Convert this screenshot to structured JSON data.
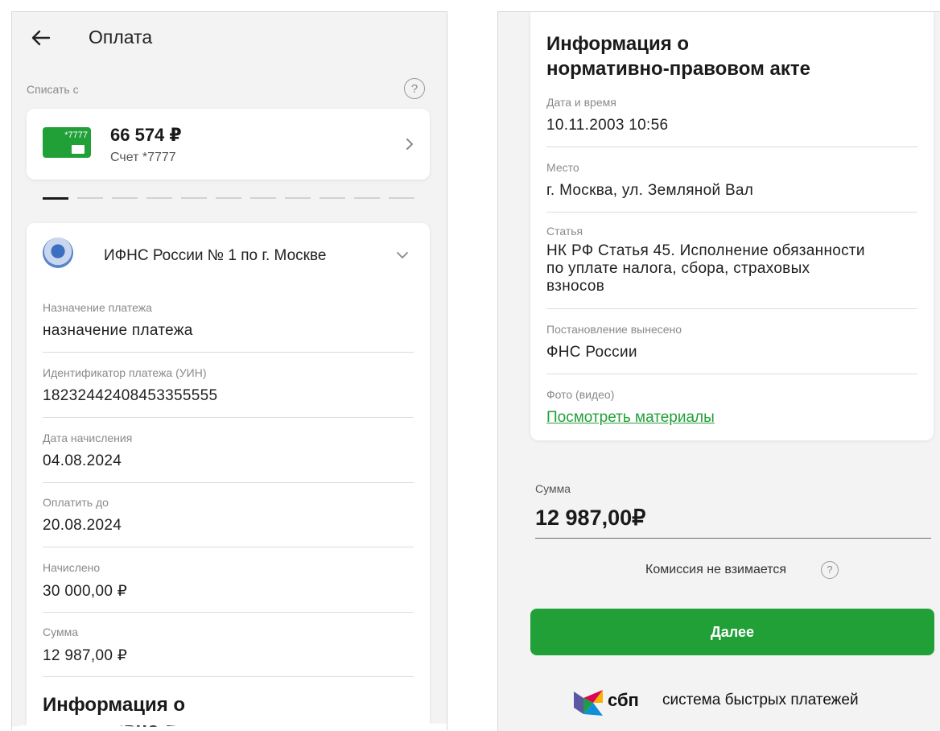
{
  "left": {
    "title": "Оплата",
    "debit_from_label": "Списать с",
    "help_glyph": "?",
    "account": {
      "card_number": "*7777",
      "balance": "66 574 ₽",
      "name": "Счет *7777"
    },
    "pager": {
      "total": 11,
      "active_index": 0
    },
    "payee": {
      "name": "ИФНС России № 1 по г. Москве",
      "fields": [
        {
          "label": "Назначение платежа",
          "value": "назначение платежа"
        },
        {
          "label": "Идентификатор платежа (УИН)",
          "value": "18232442408453355555"
        },
        {
          "label": "Дата начисления",
          "value": "04.08.2024"
        },
        {
          "label": "Оплатить до",
          "value": "20.08.2024"
        },
        {
          "label": "Начислено",
          "value": "30 000,00 ₽"
        },
        {
          "label": "Сумма",
          "value": "12 987,00 ₽"
        }
      ],
      "info_heading_line1": "Информация о",
      "info_heading_line2": "нормативно-правовом акте"
    }
  },
  "right": {
    "info_heading_line1": "Информация о",
    "info_heading_line2": "нормативно-правовом акте",
    "fields": [
      {
        "label": "Дата и время",
        "value": "10.11.2003 10:56"
      },
      {
        "label": "Место",
        "value": "г. Москва, ул. Земляной Вал"
      },
      {
        "label": "Статья",
        "value_line1": "НК РФ Статья 45. Исполнение обязанности",
        "value_line2": "по уплате налога, сбора, страховых",
        "value_line3": "взносов"
      },
      {
        "label": "Постановление вынесено",
        "value": "ФНС России"
      },
      {
        "label": "Фото (видео)",
        "link": "Посмотреть материалы"
      }
    ],
    "sum": {
      "label": "Сумма",
      "value": "12 987,00₽"
    },
    "commission_text": "Комиссия не взимается",
    "help_glyph": "?",
    "next_button": "Далее",
    "sbp": {
      "short": "сбп",
      "full": "система быстрых платежей"
    }
  },
  "colors": {
    "accent": "#21a038",
    "background": "#f3f3f3",
    "card": "#ffffff"
  },
  "icons": [
    "back-arrow-icon",
    "help-icon",
    "chevron-right-icon",
    "chevron-down-icon",
    "sbp-logo-icon"
  ]
}
